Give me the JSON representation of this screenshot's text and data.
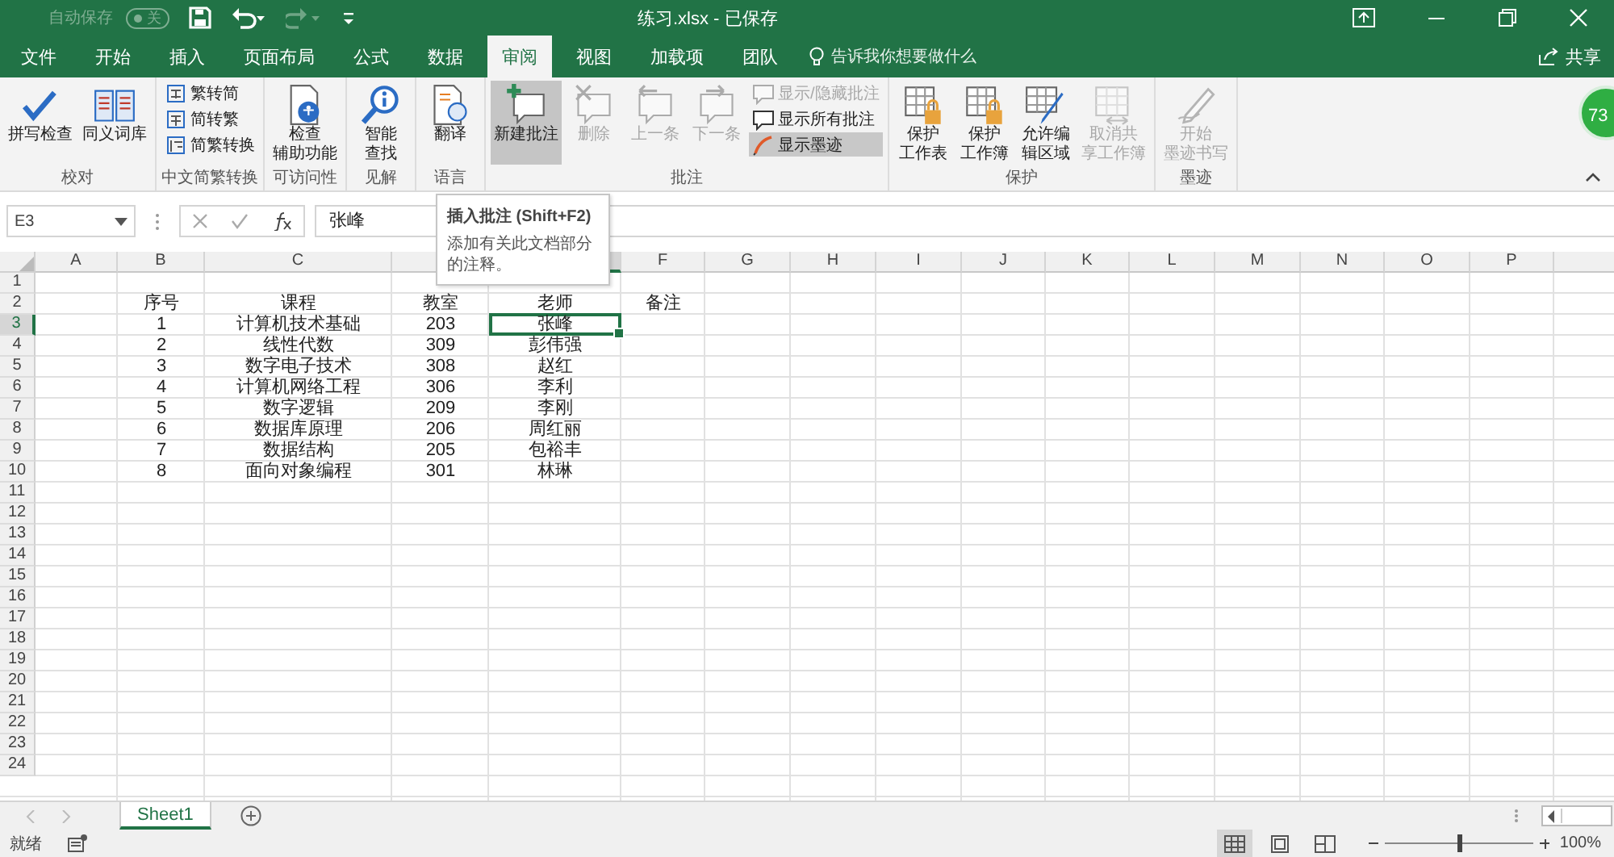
{
  "title_bar": {
    "autosave_label": "自动保存",
    "autosave_toggle": "关",
    "autosave_on": false,
    "document_title": "练习.xlsx  -  已保存"
  },
  "tabs": [
    {
      "label": "文件",
      "selected": false
    },
    {
      "label": "开始",
      "selected": false
    },
    {
      "label": "插入",
      "selected": false
    },
    {
      "label": "页面布局",
      "selected": false
    },
    {
      "label": "公式",
      "selected": false
    },
    {
      "label": "数据",
      "selected": false
    },
    {
      "label": "审阅",
      "selected": true
    },
    {
      "label": "视图",
      "selected": false
    },
    {
      "label": "加载项",
      "selected": false
    },
    {
      "label": "团队",
      "selected": false
    }
  ],
  "tell_me": {
    "placeholder": "告诉我你想要做什么"
  },
  "share_button": "共享",
  "ribbon_groups": [
    {
      "label": "校对",
      "items": [
        {
          "kind": "large",
          "label": "拼写检查",
          "disabled": false
        },
        {
          "kind": "large",
          "label": "同义词库",
          "disabled": false
        }
      ]
    },
    {
      "label": "中文简繁转换",
      "items": [
        {
          "kind": "small",
          "label": "繁转简",
          "disabled": false
        },
        {
          "kind": "small",
          "label": "简转繁",
          "disabled": false
        },
        {
          "kind": "small",
          "label": "简繁转换",
          "disabled": false
        }
      ]
    },
    {
      "label": "可访问性",
      "items": [
        {
          "kind": "large",
          "label_lines": [
            "检查",
            "辅助功能"
          ],
          "disabled": false
        }
      ]
    },
    {
      "label": "见解",
      "items": [
        {
          "kind": "large",
          "label_lines": [
            "智能",
            "查找"
          ],
          "disabled": false
        }
      ]
    },
    {
      "label": "语言",
      "items": [
        {
          "kind": "large",
          "label": "翻译",
          "disabled": false
        }
      ]
    },
    {
      "label": "批注",
      "items": [
        {
          "kind": "large",
          "label": "新建批注",
          "disabled": false,
          "hover": true
        },
        {
          "kind": "large",
          "label": "删除",
          "disabled": true
        },
        {
          "kind": "large",
          "label": "上一条",
          "disabled": true
        },
        {
          "kind": "large",
          "label": "下一条",
          "disabled": true
        },
        {
          "kind": "small",
          "label": "显示/隐藏批注",
          "disabled": true
        },
        {
          "kind": "small",
          "label": "显示所有批注",
          "disabled": false
        },
        {
          "kind": "small",
          "label": "显示墨迹",
          "disabled": false,
          "on": true
        }
      ]
    },
    {
      "label": "保护",
      "items": [
        {
          "kind": "large",
          "label_lines": [
            "保护",
            "工作表"
          ],
          "disabled": false
        },
        {
          "kind": "large",
          "label_lines": [
            "保护",
            "工作簿"
          ],
          "disabled": false
        },
        {
          "kind": "large",
          "label_lines": [
            "允许编",
            "辑区域"
          ],
          "disabled": false
        },
        {
          "kind": "large",
          "label_lines": [
            "取消共",
            "享工作簿"
          ],
          "disabled": true
        }
      ]
    },
    {
      "label": "墨迹",
      "items": [
        {
          "kind": "large",
          "label_lines": [
            "开始",
            "墨迹书写"
          ],
          "disabled": true
        }
      ]
    }
  ],
  "floating_badge": "73",
  "formula_bar": {
    "name_box": "E3",
    "value": "张峰"
  },
  "tooltip": {
    "title": "插入批注 (Shift+F2)",
    "body": "添加有关此文档部分的注释。"
  },
  "columns": [
    {
      "label": "A",
      "selected": false
    },
    {
      "label": "B",
      "selected": false
    },
    {
      "label": "C",
      "selected": false
    },
    {
      "selected": false
    },
    {
      "selected": true
    },
    {
      "label": "F",
      "selected": false
    },
    {
      "label": "G",
      "selected": false
    },
    {
      "label": "H",
      "selected": false
    },
    {
      "label": "I",
      "selected": false
    },
    {
      "label": "J",
      "selected": false
    },
    {
      "label": "K",
      "selected": false
    },
    {
      "label": "L",
      "selected": false
    },
    {
      "label": "M",
      "selected": false
    },
    {
      "label": "N",
      "selected": false
    },
    {
      "label": "O",
      "selected": false
    },
    {
      "label": "P",
      "selected": false
    },
    {
      "selected": false
    }
  ],
  "rows": [
    {
      "number": "1",
      "selected": false
    },
    {
      "number": "2",
      "selected": false,
      "cells": {
        "B": "序号",
        "C": "课程",
        "D": "教室",
        "E": "老师",
        "F": "备注"
      }
    },
    {
      "number": "3",
      "selected": true,
      "cells": {
        "B": "1",
        "C": "计算机技术基础",
        "D": "203",
        "E": "张峰"
      }
    },
    {
      "number": "4",
      "selected": false,
      "cells": {
        "B": "2",
        "C": "线性代数",
        "D": "309",
        "E": "彭伟强"
      }
    },
    {
      "number": "5",
      "selected": false,
      "cells": {
        "B": "3",
        "C": "数字电子技术",
        "D": "308",
        "E": "赵红"
      }
    },
    {
      "number": "6",
      "selected": false,
      "cells": {
        "B": "4",
        "C": "计算机网络工程",
        "D": "306",
        "E": "李利"
      }
    },
    {
      "number": "7",
      "selected": false,
      "cells": {
        "B": "5",
        "C": "数字逻辑",
        "D": "209",
        "E": "李刚"
      }
    },
    {
      "number": "8",
      "selected": false,
      "cells": {
        "B": "6",
        "C": "数据库原理",
        "D": "206",
        "E": "周红丽"
      }
    },
    {
      "number": "9",
      "selected": false,
      "cells": {
        "B": "7",
        "C": "数据结构",
        "D": "205",
        "E": "包裕丰"
      }
    },
    {
      "number": "10",
      "selected": false,
      "cells": {
        "B": "8",
        "C": "面向对象编程",
        "D": "301",
        "E": "林琳"
      }
    },
    {
      "number": "11",
      "selected": false
    },
    {
      "number": "12",
      "selected": false
    },
    {
      "number": "13",
      "selected": false
    },
    {
      "number": "14",
      "selected": false
    },
    {
      "number": "15",
      "selected": false
    },
    {
      "number": "16",
      "selected": false
    },
    {
      "number": "17",
      "selected": false
    },
    {
      "number": "18",
      "selected": false
    },
    {
      "number": "19",
      "selected": false
    },
    {
      "number": "20",
      "selected": false
    },
    {
      "number": "21",
      "selected": false
    },
    {
      "number": "22",
      "selected": false
    },
    {
      "number": "23",
      "selected": false
    },
    {
      "number": "24",
      "selected": false
    }
  ],
  "sheet_tabs": [
    {
      "label": "Sheet1",
      "selected": true
    }
  ],
  "status_bar": {
    "status": "就绪",
    "zoom": {
      "reading": "100%",
      "level": 0.5
    },
    "views": [
      {
        "selected": true
      },
      {
        "selected": false
      },
      {
        "selected": false
      }
    ]
  }
}
